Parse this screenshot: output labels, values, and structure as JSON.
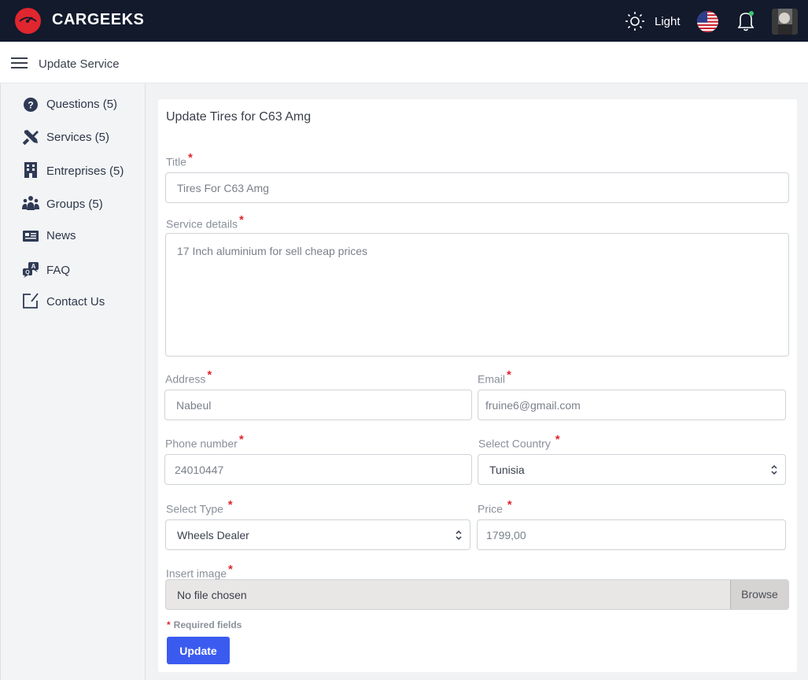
{
  "app": {
    "brand": "CARGEEKS",
    "theme_label": "Light",
    "brand_color": "#e0262f",
    "topbar_color": "#121a2c",
    "accent_color": "#3b5bf0"
  },
  "header": {
    "page_title": "Update Service"
  },
  "sidebar": {
    "items": [
      {
        "label": "Questions (5)",
        "icon": "question-circle-icon"
      },
      {
        "label": "Services (5)",
        "icon": "tools-icon"
      },
      {
        "label": "Entreprises (5)",
        "icon": "building-icon"
      },
      {
        "label": "Groups (5)",
        "icon": "users-icon"
      },
      {
        "label": "News",
        "icon": "newspaper-icon"
      },
      {
        "label": "FAQ",
        "icon": "chat-icon"
      },
      {
        "label": "Contact Us",
        "icon": "edit-icon"
      }
    ]
  },
  "form": {
    "title": "Update Tires for C63 Amg",
    "required_mark": "*",
    "title_label": "Title",
    "title_value": "Tires For C63 Amg",
    "details_label": "Service details",
    "details_value": "17 Inch aluminium for sell cheap prices",
    "address_label": "Address",
    "address_value": "Nabeul",
    "email_label": "Email",
    "email_value": "fruine6@gmail.com",
    "phone_label": "Phone number",
    "phone_value": "24010447",
    "country_label": "Select Country",
    "country_value": "Tunisia",
    "type_label": "Select Type",
    "type_value": "Wheels Dealer",
    "price_label": "Price",
    "price_value": "1799,00",
    "image_label": "Insert image",
    "file_text": "No file chosen",
    "browse_label": "Browse",
    "required_note": "Required fields",
    "submit_label": "Update"
  }
}
